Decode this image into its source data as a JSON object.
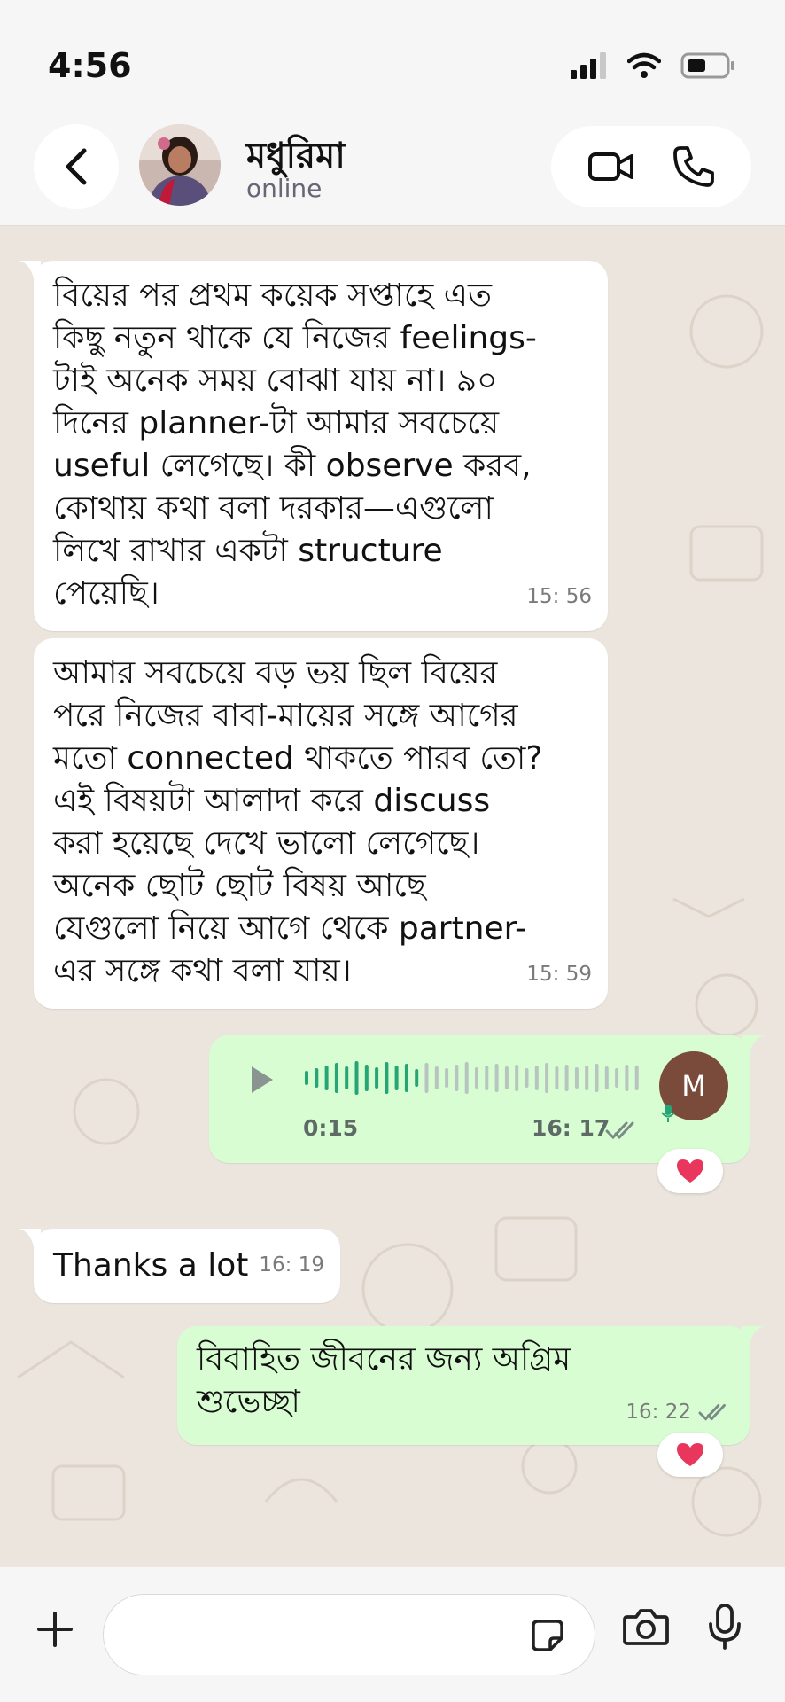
{
  "status_bar": {
    "time": "4:56"
  },
  "header": {
    "contact_name": "মধুরিমা",
    "contact_status": "online"
  },
  "messages": [
    {
      "direction": "incoming",
      "text": "বিয়ের পর প্রথম কয়েক সপ্তাহে এত\nকিছু নতুন থাকে যে নিজের feelings-\nটাই অনেক সময় বোঝা যায় না। ৯০\nদিনের planner-টা আমার সবচেয়ে\nuseful লেগেছে। কী observe করব,\nকোথায় কথা বলা দরকার—এগুলো\nলিখে রাখার একটা structure\nপেয়েছি।",
      "time": "15: 56"
    },
    {
      "direction": "incoming",
      "text": "আমার সবচেয়ে বড় ভয় ছিল বিয়ের\nপরে নিজের বাবা-মায়ের সঙ্গে আগের\nমতো connected থাকতে পারব তো?\nএই বিষয়টা আলাদা করে discuss\nকরা হয়েছে দেখে ভালো লেগেছে।\nঅনেক ছোট ছোট বিষয় আছে\nযেগুলো নিয়ে আগে থেকে partner-\nএর সঙ্গে কথা বলা যায়।",
      "time": "15: 59"
    },
    {
      "direction": "outgoing",
      "type": "voice",
      "duration": "0:15",
      "time": "16: 17",
      "avatar_letter": "M",
      "played_fraction": 0.35,
      "reaction": "heart"
    },
    {
      "direction": "incoming",
      "text": "Thanks a lot",
      "time": "16: 19"
    },
    {
      "direction": "outgoing",
      "text": "বিবাহিত জীবনের জন্য অগ্রিম\nশুভেচ্ছা",
      "time": "16: 22",
      "reaction": "heart"
    }
  ],
  "input": {
    "placeholder": ""
  },
  "colors": {
    "outgoing_bubble": "#d9fdd3",
    "incoming_bubble": "#ffffff",
    "chat_background": "#ece5dd",
    "waveform_played": "#25a474",
    "waveform_unplayed": "#b8c4bf",
    "read_ticks": "#7a8a86",
    "heart": "#e8365d"
  }
}
